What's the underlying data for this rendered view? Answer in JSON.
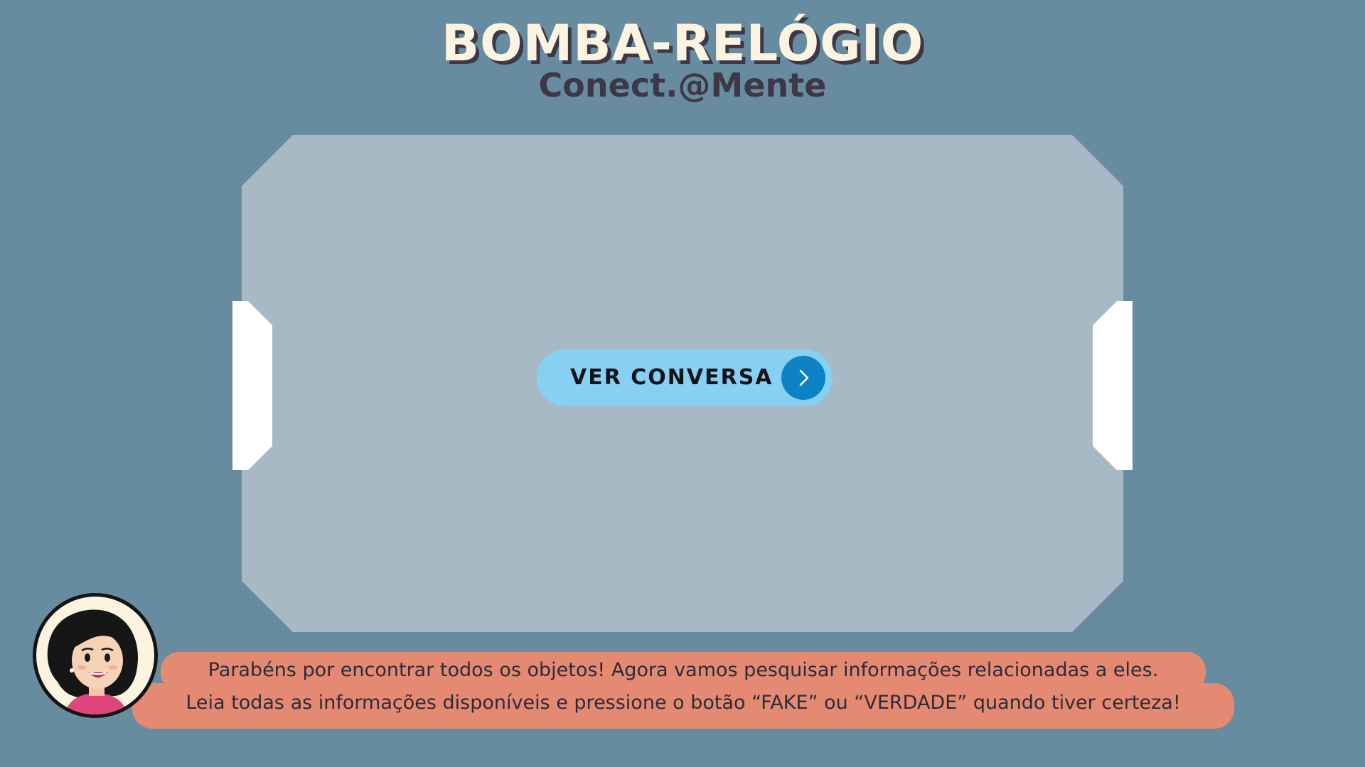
{
  "header": {
    "title": "BOMBA-RELÓGIO",
    "subtitle": "Conect.@Mente"
  },
  "board": {
    "button_label": "VER CONVERSA",
    "button_icon": "chevron-right-icon"
  },
  "dialog": {
    "character": "woman-avatar",
    "line1": "Parabéns por encontrar todos os objetos! Agora vamos pesquisar informações relacionadas a eles.",
    "line2": "Leia todas as informações disponíveis e pressione o botão “FAKE” ou “VERDADE” quando tiver certeza!"
  },
  "colors": {
    "background": "#688c9f",
    "board": "#a6b9c5",
    "button": "#86d0f4",
    "button_icon_bg": "#0d83c5",
    "bubble": "#e48a72",
    "title": "#fdf3e1",
    "subtitle": "#3d3748"
  }
}
